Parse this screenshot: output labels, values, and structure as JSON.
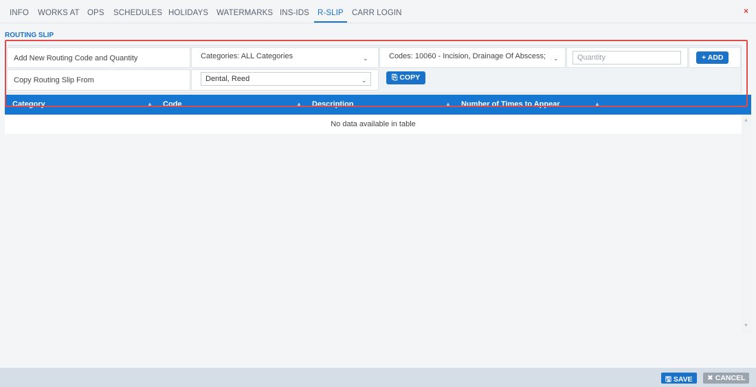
{
  "tabs": [
    {
      "label": "INFO"
    },
    {
      "label": "WORKS AT"
    },
    {
      "label": "OPS"
    },
    {
      "label": "SCHEDULES"
    },
    {
      "label": "HOLIDAYS"
    },
    {
      "label": "WATERMARKS"
    },
    {
      "label": "INS-IDS"
    },
    {
      "label": "R-SLIP"
    },
    {
      "label": "CARR LOGIN"
    }
  ],
  "active_tab": "R-SLIP",
  "close_glyph": "×",
  "section_title": "ROUTING SLIP",
  "form": {
    "add_label": "Add New Routing Code and Quantity",
    "category_select": "Categories: ALL Categories",
    "codes_select": "Codes: 10060 - Incision, Drainage Of Abscess;",
    "quantity_placeholder": "Quantity",
    "add_button": "ADD",
    "copy_label": "Copy Routing Slip From",
    "copy_from_select": "Dental, Reed",
    "copy_button": "COPY"
  },
  "table": {
    "columns": [
      "Category",
      "Code",
      "Description",
      "Number of Times to Appear"
    ],
    "empty_message": "No data available in table"
  },
  "footer": {
    "save_label": "SAVE",
    "cancel_label": "CANCEL"
  },
  "colors": {
    "accent": "#1a73c9",
    "header_bg": "#1677d2",
    "highlight_outline": "#e24a4a",
    "close": "#e03a3a",
    "cancel_bg": "#9aa3ae"
  },
  "icons": [
    "close-icon",
    "chevron-down-icon",
    "plus-icon",
    "copy-icon",
    "sort-icon",
    "save-icon",
    "cancel-icon"
  ]
}
